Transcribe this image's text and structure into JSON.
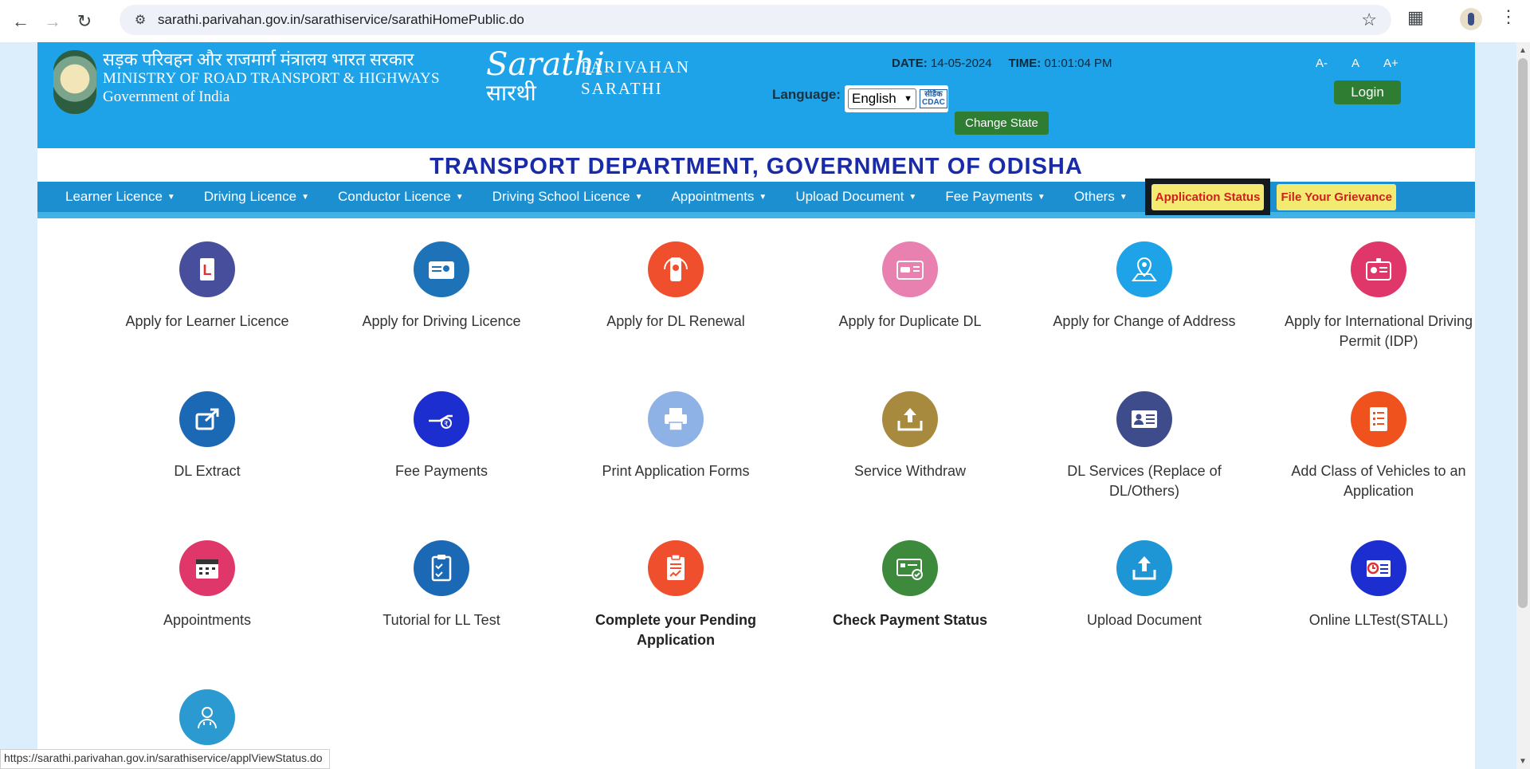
{
  "browser": {
    "url": "sarathi.parivahan.gov.in/sarathiservice/sarathiHomePublic.do",
    "icons": [
      "back-arrow-icon",
      "forward-arrow-icon",
      "reload-icon",
      "site-info-icon",
      "star-icon",
      "extensions-icon",
      "profile-avatar",
      "kebab-menu-icon"
    ]
  },
  "header": {
    "ministry_hindi": "सड़क परिवहन और राजमार्ग मंत्रालय भारत सरकार",
    "ministry_english": "MINISTRY OF ROAD TRANSPORT & HIGHWAYS",
    "government": "Government of India",
    "logo_script": "Sarathi",
    "logo_script_hindi": "सारथी",
    "logo_line1": "PARIVAHAN",
    "logo_line2": "SARATHI",
    "date_label": "DATE:",
    "date_value": "14-05-2024",
    "time_label": "TIME:",
    "time_value": "01:01:04 PM",
    "language_label": "Language:",
    "language_selected": "English",
    "cdac_line1": "सीडैक",
    "cdac_line2": "CDAC",
    "change_state": "Change State",
    "font_small": "A-",
    "font_normal": "A",
    "font_large": "A+",
    "login": "Login"
  },
  "department_title": "TRANSPORT DEPARTMENT, GOVERNMENT OF ODISHA",
  "nav": {
    "items": [
      "Learner Licence",
      "Driving Licence",
      "Conductor Licence",
      "Driving School Licence",
      "Appointments",
      "Upload Document",
      "Fee Payments",
      "Others"
    ],
    "application_status": "Application Status",
    "grievance": "File Your Grievance"
  },
  "services": [
    {
      "label": "Apply for Learner Licence",
      "color": "#474f9c",
      "icon": "learner-licence-icon"
    },
    {
      "label": "Apply for Driving Licence",
      "color": "#1e73b8",
      "icon": "driving-licence-card-icon"
    },
    {
      "label": "Apply for DL Renewal",
      "color": "#ef4f2d",
      "icon": "renewal-phone-icon"
    },
    {
      "label": "Apply for Duplicate DL",
      "color": "#e880b0",
      "icon": "duplicate-dl-car-icon"
    },
    {
      "label": "Apply for Change of Address",
      "color": "#1ea2e8",
      "icon": "location-pin-icon"
    },
    {
      "label": "Apply for International Driving Permit (IDP)",
      "color": "#e0376b",
      "icon": "idp-badge-icon"
    },
    {
      "label": "DL Extract",
      "color": "#1b69b5",
      "icon": "share-extract-icon"
    },
    {
      "label": "Fee Payments",
      "color": "#1c2ed0",
      "icon": "fee-hand-coin-icon"
    },
    {
      "label": "Print Application Forms",
      "color": "#8fb2e6",
      "icon": "printer-icon"
    },
    {
      "label": "Service Withdraw",
      "color": "#a88a3f",
      "icon": "upload-tray-icon"
    },
    {
      "label": "DL Services (Replace of DL/Others)",
      "color": "#3e4c8c",
      "icon": "id-card-icon"
    },
    {
      "label": "Add Class of Vehicles to an Application",
      "color": "#f0521d",
      "icon": "form-list-icon"
    },
    {
      "label": "Appointments",
      "color": "#e0376b",
      "icon": "calendar-icon"
    },
    {
      "label": "Tutorial for LL Test",
      "color": "#1b69b5",
      "icon": "checklist-icon"
    },
    {
      "label": "Complete your Pending Application",
      "color": "#ef4f2d",
      "icon": "clipboard-chart-icon"
    },
    {
      "label": "Check Payment Status",
      "color": "#3d8a3d",
      "icon": "payment-card-check-icon"
    },
    {
      "label": "Upload Document",
      "color": "#1e95d4",
      "icon": "upload-box-icon"
    },
    {
      "label": "Online LLTest(STALL)",
      "color": "#1c2ed0",
      "icon": "clock-id-icon"
    },
    {
      "label": "",
      "color": "#2b9ad0",
      "icon": "doctor-icon"
    }
  ],
  "bold_labels": [
    "Complete your Pending Application",
    "Check Payment Status"
  ],
  "status_bar_link": "https://sarathi.parivahan.gov.in/sarathiservice/applViewStatus.do"
}
